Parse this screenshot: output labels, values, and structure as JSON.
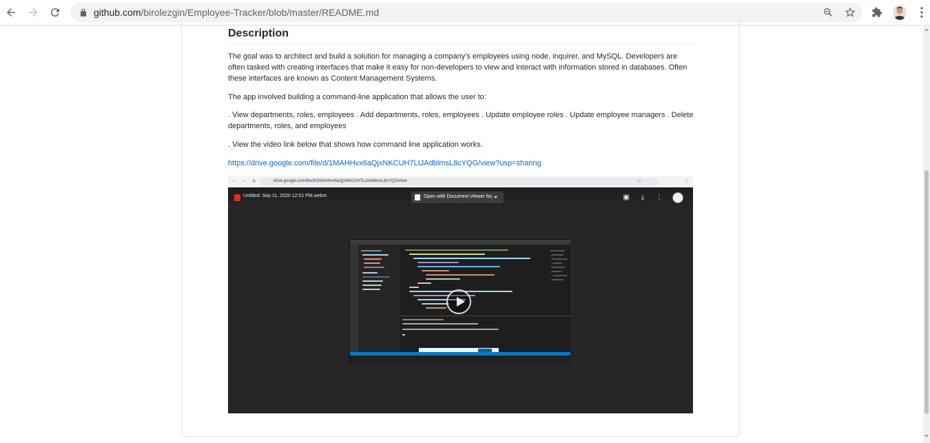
{
  "browser": {
    "url_host": "github.com",
    "url_path": "/birolezgin/Employee-Tracker/blob/master/README.md"
  },
  "readme": {
    "heading": "Description",
    "paragraph_1": "The goal was to architect and build a solution for managing a company's employees using node, inquirer, and MySQL. Developers are often tasked with creating interfaces that make it easy for non-developers to view and interact with information stored in databases. Often these interfaces are known as Content Management Systems.",
    "paragraph_2": "The app involved building a command-line application that allows the user to:",
    "paragraph_3": ". View departments, roles, employees . Add departments, roles, employees . Update employee roles . Update employee managers . Delete departments, roles, and employees",
    "paragraph_4": ". View the video link below that shows how command line application works.",
    "video_link": "https://drive.google.com/file/d/1MAHHvx6aQjxNKCUH7LtJAdblmsL8cYQG/view?usp=sharing"
  },
  "embedded": {
    "url": "drive.google.com/file/d/1MAHHvx6aQjxNKCUH7LtJAdblmsL8cYQG/view",
    "file_name": "Untitled: Sep 11, 2020 12:51 PM.webm",
    "open_with": "Open with Document Viewer for...",
    "dropdown": "▾"
  }
}
